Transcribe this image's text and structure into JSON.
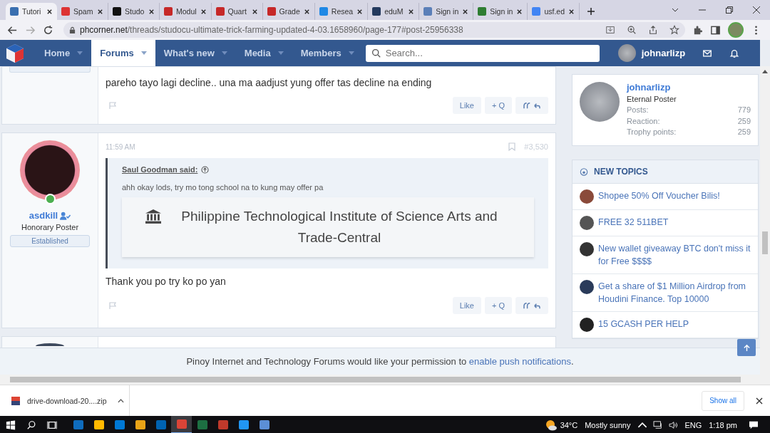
{
  "browser": {
    "tabs": [
      {
        "title": "Tutori",
        "selected": true
      },
      {
        "title": "Spam",
        "selected": false
      },
      {
        "title": "Studo",
        "selected": false
      },
      {
        "title": "Modul",
        "selected": false
      },
      {
        "title": "Quart",
        "selected": false
      },
      {
        "title": "Grade",
        "selected": false
      },
      {
        "title": "Resea",
        "selected": false
      },
      {
        "title": "eduM",
        "selected": false
      },
      {
        "title": "Sign in",
        "selected": false
      },
      {
        "title": "Sign in",
        "selected": false
      },
      {
        "title": "usf.ed",
        "selected": false
      }
    ],
    "address": {
      "domain": "phcorner.net",
      "path": "/threads/studocu-ultimate-trick-farming-updated-4-03.1658960/page-177#post-25956338"
    }
  },
  "nav": {
    "items": [
      {
        "label": "Home",
        "selected": false
      },
      {
        "label": "Forums",
        "selected": true
      },
      {
        "label": "What's new",
        "selected": false
      },
      {
        "label": "Media",
        "selected": false
      },
      {
        "label": "Members",
        "selected": false
      }
    ],
    "search": {
      "placeholder": "Search..."
    },
    "username": "johnarlizp"
  },
  "posts": [
    {
      "body": "pareho tayo lagi decline.. una ma aadjust yung offer tas decline na ending",
      "actions": [
        "Like",
        "+ Q"
      ]
    },
    {
      "author": "asdkill",
      "role": "Honorary Poster",
      "badge": "Established",
      "time": "11:59 AM",
      "number": "#3,530",
      "quote": {
        "author": "Saul Goodman said:",
        "text": "ahh okay lods, try mo tong school na to kung may offer pa",
        "embed": "Philippine Technological Institute of Science Arts and Trade-Central"
      },
      "body": "Thank you po try ko po yan",
      "actions": [
        "Like",
        "+ Q"
      ]
    }
  ],
  "sidebar": {
    "profile": {
      "name": "johnarlizp",
      "title": "Eternal Poster",
      "stats": [
        {
          "label": "Posts:",
          "value": "779"
        },
        {
          "label": "Reaction:",
          "value": "259"
        },
        {
          "label": "Trophy points:",
          "value": "259"
        }
      ]
    },
    "new_topics": {
      "title": "NEW TOPICS",
      "items": [
        "Shopee 50% Off Voucher Bilis!",
        "FREE 32 511BET",
        "New wallet giveaway BTC don't miss it for Free $$$$",
        "Get a share of $1 Million Airdrop from Houdini Finance. Top 10000",
        "15 GCASH PER HELP"
      ]
    }
  },
  "notice": {
    "text": "Pinoy Internet and Technology Forums would like your permission to",
    "link": "enable push notifications",
    "end": "."
  },
  "downloads": {
    "file": "drive-download-20....zip",
    "show_all": "Show all"
  },
  "taskbar": {
    "temperature": "34°C",
    "weather": "Mostly sunny",
    "language": "ENG",
    "time": "1:18 pm"
  }
}
